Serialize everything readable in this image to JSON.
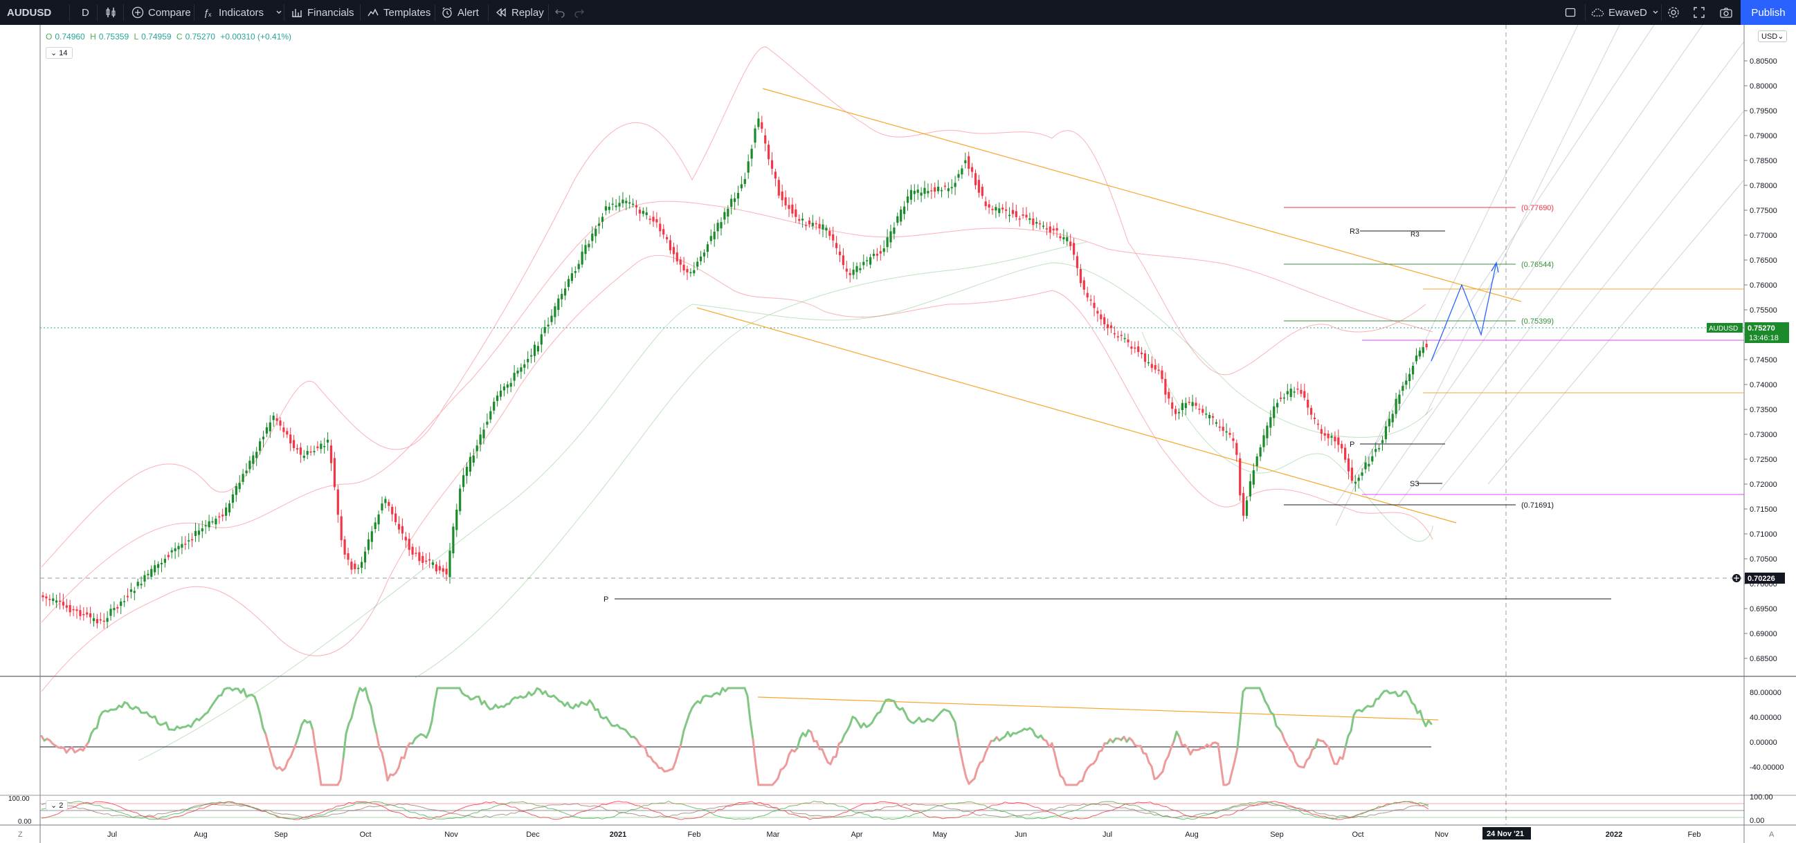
{
  "toolbar": {
    "symbol": "AUDUSD",
    "interval": "D",
    "compare": "Compare",
    "indicators": "Indicators",
    "financials": "Financials",
    "templates": "Templates",
    "alert": "Alert",
    "replay": "Replay",
    "layout_name": "EwaveD",
    "publish": "Publish"
  },
  "legend": {
    "o_label": "O",
    "o": "0.74960",
    "h_label": "H",
    "h": "0.75359",
    "l_label": "L",
    "l": "0.74959",
    "c_label": "C",
    "c": "0.75270",
    "change": "+0.00310 (+0.41%)",
    "collapse_count": "14",
    "osc_count": "2"
  },
  "currency": "USD",
  "price_axis": [
    "0.80500",
    "0.80000",
    "0.79500",
    "0.79000",
    "0.78500",
    "0.78000",
    "0.77500",
    "0.77000",
    "0.76500",
    "0.76000",
    "0.75500",
    "0.75000",
    "0.74500",
    "0.74000",
    "0.73500",
    "0.73000",
    "0.72500",
    "0.72000",
    "0.71500",
    "0.71000",
    "0.70500",
    "0.70000",
    "0.69500",
    "0.69000",
    "0.68500"
  ],
  "last_price": {
    "symbol_tag": "AUDUSD",
    "value": "0.75270",
    "countdown": "13:46:18"
  },
  "crosshair_price": "0.70226",
  "levels": [
    {
      "label": "(0.77690)",
      "color": "#f23645"
    },
    {
      "label": "(0.76544)",
      "color": "#388e3c"
    },
    {
      "label": "(0.75399)",
      "color": "#388e3c"
    },
    {
      "label": "(0.71691)",
      "color": "#131722"
    }
  ],
  "pivot_labels": {
    "r3a": "R3",
    "r3b": "R3",
    "p": "P",
    "s3": "S3",
    "p2": "P"
  },
  "osc_axis": [
    "80.00000",
    "40.00000",
    "0.00000",
    "-40.00000"
  ],
  "osc2_axis_left": [
    "100.00",
    "0.00"
  ],
  "osc2_axis_right": [
    "100.00",
    "0.00"
  ],
  "time_axis": [
    "Jul",
    "Aug",
    "Sep",
    "Oct",
    "Nov",
    "Dec",
    "2021",
    "Feb",
    "Mar",
    "Apr",
    "May",
    "Jun",
    "Jul",
    "Aug",
    "Sep",
    "Oct",
    "Nov",
    "2022",
    "Feb"
  ],
  "time_cursor": "24 Nov '21",
  "corner_left": "Z",
  "corner_right": "A",
  "colors": {
    "up": "#26a69a",
    "up_bar": "#1b8a2a",
    "down": "#f23645",
    "channel": "#f7a62b",
    "magenta": "#e040fb",
    "wave": "#2962ff"
  }
}
